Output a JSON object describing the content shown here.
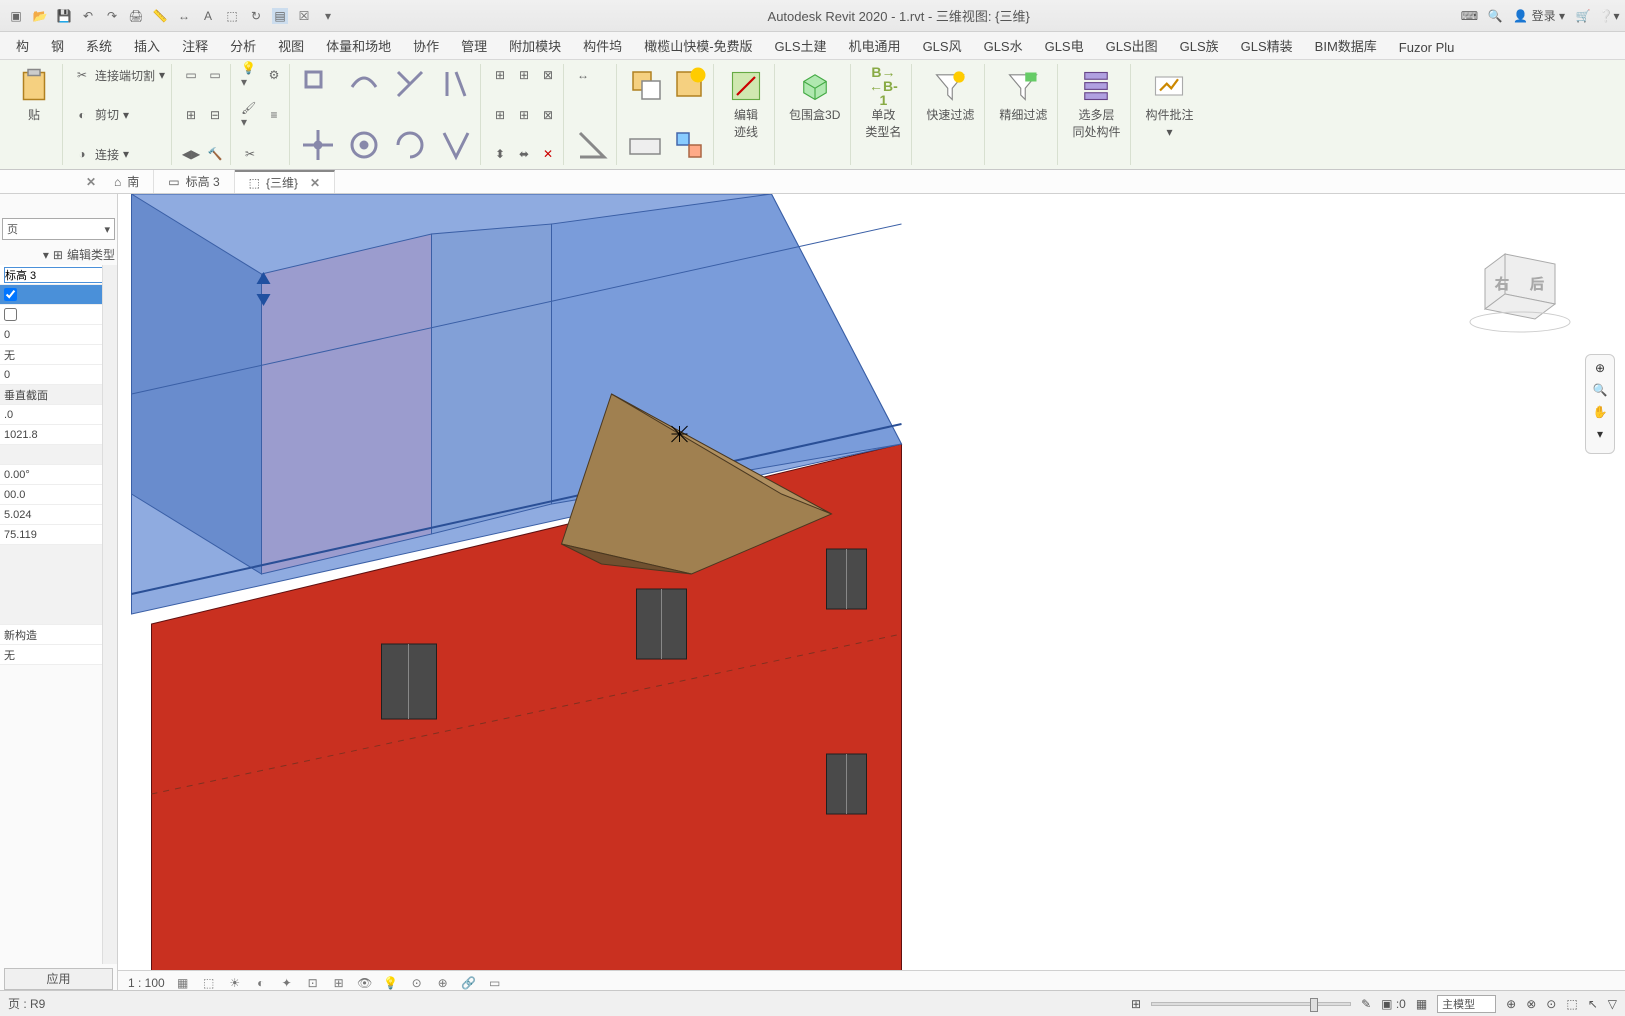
{
  "app_title": "Autodesk Revit 2020 - 1.rvt - 三维视图: {三维}",
  "login_label": "登录",
  "ribbon_tabs": [
    "构",
    "钢",
    "系统",
    "插入",
    "注释",
    "分析",
    "视图",
    "体量和场地",
    "协作",
    "管理",
    "附加模块",
    "构件坞",
    "橄榄山快模-免费版",
    "GLS土建",
    "机电通用",
    "GLS风",
    "GLS水",
    "GLS电",
    "GLS出图",
    "GLS族",
    "GLS精装",
    "BIM数据库",
    "Fuzor Plu"
  ],
  "clipboard": {
    "cut": "连接端切割",
    "trim": "剪切",
    "join": "连接"
  },
  "big_buttons": {
    "edit_path": "编辑\n迹线",
    "box3d": "包围盒3D",
    "single_type": "单改\n类型名",
    "quick_filter": "快速过滤",
    "fine_filter": "精细过滤",
    "multi_layer": "选多层\n同处构件",
    "annotation": "构件批注"
  },
  "viewtabs": {
    "south": "南",
    "level3": "标高 3",
    "three_d": "{三维}"
  },
  "properties": {
    "dropdown": "页",
    "edit_type": "编辑类型",
    "level_bind": "标高 3",
    "vals": [
      "0",
      "无",
      "0",
      "垂直截面",
      ".0",
      "1021.8",
      "0.00°",
      "00.0",
      "5.024",
      "75.119",
      "新构造",
      "无"
    ],
    "apply": "应用"
  },
  "view_scale": "1 : 100",
  "status_left": "页 : R9",
  "filter_count": ":0",
  "status_model": "主模型"
}
